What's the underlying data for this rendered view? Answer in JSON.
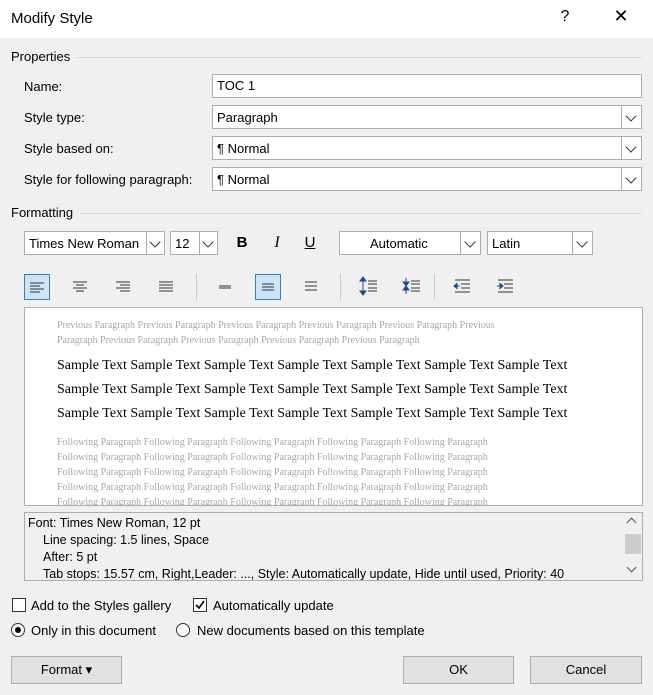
{
  "window": {
    "title": "Modify Style",
    "help_glyph": "?",
    "close_glyph": "✕"
  },
  "properties": {
    "section_label": "Properties",
    "name_label": "Name:",
    "name_value": "TOC 1",
    "style_type_label": "Style type:",
    "style_type_value": "Paragraph",
    "based_on_label": "Style based on:",
    "based_on_value": "¶  Normal",
    "following_label": "Style for following paragraph:",
    "following_value": "¶  Normal"
  },
  "formatting": {
    "section_label": "Formatting",
    "font_name": "Times New Roman",
    "font_size": "12",
    "bold": "B",
    "italic": "I",
    "underline": "U",
    "color": "Automatic",
    "script": "Latin"
  },
  "preview": {
    "previous_lines": [
      "Previous Paragraph Previous Paragraph Previous Paragraph Previous Paragraph Previous Paragraph Previous",
      "Paragraph Previous Paragraph Previous Paragraph Previous Paragraph Previous Paragraph"
    ],
    "sample_lines": [
      "Sample Text Sample Text Sample Text Sample Text Sample Text Sample Text Sample Text",
      "Sample Text Sample Text Sample Text Sample Text Sample Text Sample Text Sample Text",
      "Sample Text Sample Text Sample Text Sample Text Sample Text Sample Text Sample Text"
    ],
    "following_lines": [
      "Following Paragraph Following Paragraph Following Paragraph Following Paragraph Following Paragraph",
      "Following Paragraph Following Paragraph Following Paragraph Following Paragraph Following Paragraph",
      "Following Paragraph Following Paragraph Following Paragraph Following Paragraph Following Paragraph",
      "Following Paragraph Following Paragraph Following Paragraph Following Paragraph Following Paragraph",
      "Following Paragraph Following Paragraph Following Paragraph Following Paragraph Following Paragraph"
    ]
  },
  "description": {
    "lines": [
      "Font: Times New Roman, 12 pt",
      "Line spacing:  1.5 lines, Space",
      "After:  5 pt",
      "Tab stops:  15.57 cm, Right,Leader: ..., Style: Automatically update, Hide until used, Priority: 40"
    ]
  },
  "options": {
    "add_to_gallery": "Add to the Styles gallery",
    "add_to_gallery_checked": false,
    "auto_update": "Automatically update",
    "auto_update_checked": true,
    "only_this_doc": "Only in this document",
    "new_docs": "New documents based on this template"
  },
  "buttons": {
    "format": "Format ▾",
    "ok": "OK",
    "cancel": "Cancel"
  },
  "colors": {
    "selected_fill": "#cce4f7",
    "selected_border": "#3c7fb1"
  }
}
